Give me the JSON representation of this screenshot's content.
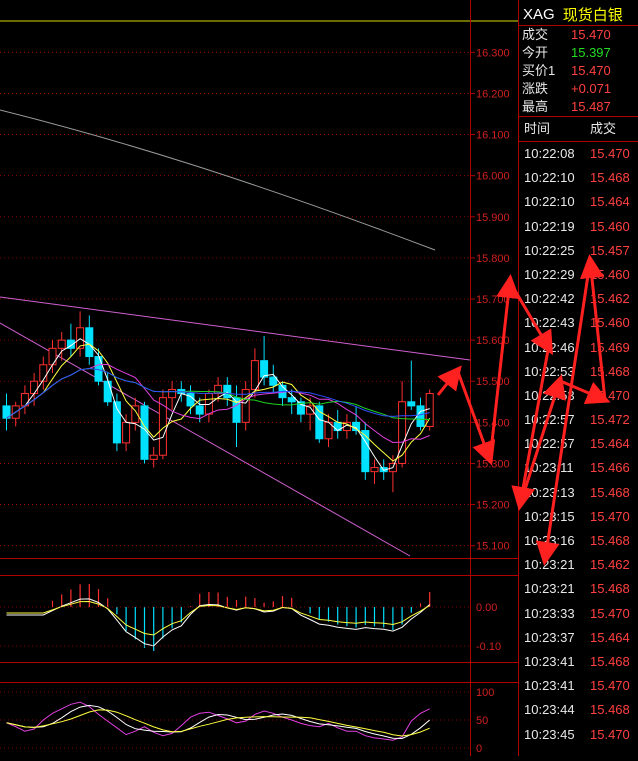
{
  "header": {
    "symbol": "XAG",
    "name": "现货白银"
  },
  "quote": [
    {
      "label": "成交",
      "value": "15.470",
      "color": "#ff4040"
    },
    {
      "label": "今开",
      "value": "15.397",
      "color": "#22dd22"
    },
    {
      "label": "买价1",
      "value": "15.470",
      "color": "#ff4040"
    },
    {
      "label": "涨跌",
      "value": "+0.071",
      "color": "#ff4040"
    },
    {
      "label": "最高",
      "value": "15.487",
      "color": "#ff4040"
    }
  ],
  "ticks": {
    "time_header": "时间",
    "price_header": "成交",
    "rows": [
      {
        "time": "10:22:08",
        "price": "15.470"
      },
      {
        "time": "10:22:10",
        "price": "15.468"
      },
      {
        "time": "10:22:10",
        "price": "15.464"
      },
      {
        "time": "10:22:19",
        "price": "15.460"
      },
      {
        "time": "10:22:25",
        "price": "15.457"
      },
      {
        "time": "10:22:29",
        "price": "15.460"
      },
      {
        "time": "10:22:42",
        "price": "15.462"
      },
      {
        "time": "10:22:43",
        "price": "15.460"
      },
      {
        "time": "10:22:46",
        "price": "15.469"
      },
      {
        "time": "10:22:53",
        "price": "15.468"
      },
      {
        "time": "10:22:53",
        "price": "15.470"
      },
      {
        "time": "10:22:57",
        "price": "15.472"
      },
      {
        "time": "10:22:57",
        "price": "15.464"
      },
      {
        "time": "10:23:11",
        "price": "15.466"
      },
      {
        "time": "10:23:13",
        "price": "15.468"
      },
      {
        "time": "10:23:15",
        "price": "15.470"
      },
      {
        "time": "10:23:16",
        "price": "15.468"
      },
      {
        "time": "10:23:21",
        "price": "15.462"
      },
      {
        "time": "10:23:21",
        "price": "15.468"
      },
      {
        "time": "10:23:33",
        "price": "15.470"
      },
      {
        "time": "10:23:37",
        "price": "15.464"
      },
      {
        "time": "10:23:41",
        "price": "15.468"
      },
      {
        "time": "10:23:41",
        "price": "15.470"
      },
      {
        "time": "10:23:44",
        "price": "15.468"
      },
      {
        "time": "10:23:45",
        "price": "15.470"
      }
    ]
  },
  "chart_data": [
    {
      "type": "candlestick",
      "y_ticks": [
        "16.300",
        "16.200",
        "16.100",
        "16.000",
        "15.900",
        "15.800",
        "15.700",
        "15.600",
        "15.500",
        "15.400",
        "15.300",
        "15.200",
        "15.100"
      ],
      "ylim": [
        15.07,
        16.33
      ],
      "candles": [
        {
          "o": 15.44,
          "h": 15.47,
          "l": 15.38,
          "c": 15.41
        },
        {
          "o": 15.41,
          "h": 15.45,
          "l": 15.39,
          "c": 15.44
        },
        {
          "o": 15.44,
          "h": 15.49,
          "l": 15.42,
          "c": 15.47
        },
        {
          "o": 15.47,
          "h": 15.52,
          "l": 15.44,
          "c": 15.5
        },
        {
          "o": 15.5,
          "h": 15.56,
          "l": 15.48,
          "c": 15.54
        },
        {
          "o": 15.54,
          "h": 15.6,
          "l": 15.52,
          "c": 15.58
        },
        {
          "o": 15.58,
          "h": 15.62,
          "l": 15.55,
          "c": 15.6
        },
        {
          "o": 15.6,
          "h": 15.64,
          "l": 15.56,
          "c": 15.58
        },
        {
          "o": 15.58,
          "h": 15.67,
          "l": 15.56,
          "c": 15.63
        },
        {
          "o": 15.63,
          "h": 15.66,
          "l": 15.54,
          "c": 15.56
        },
        {
          "o": 15.56,
          "h": 15.58,
          "l": 15.49,
          "c": 15.5
        },
        {
          "o": 15.5,
          "h": 15.52,
          "l": 15.44,
          "c": 15.45
        },
        {
          "o": 15.45,
          "h": 15.47,
          "l": 15.33,
          "c": 15.35
        },
        {
          "o": 15.35,
          "h": 15.42,
          "l": 15.33,
          "c": 15.4
        },
        {
          "o": 15.4,
          "h": 15.46,
          "l": 15.38,
          "c": 15.44
        },
        {
          "o": 15.44,
          "h": 15.45,
          "l": 15.3,
          "c": 15.31
        },
        {
          "o": 15.31,
          "h": 15.34,
          "l": 15.29,
          "c": 15.32
        },
        {
          "o": 15.32,
          "h": 15.48,
          "l": 15.31,
          "c": 15.46
        },
        {
          "o": 15.46,
          "h": 15.5,
          "l": 15.43,
          "c": 15.48
        },
        {
          "o": 15.48,
          "h": 15.5,
          "l": 15.45,
          "c": 15.47
        },
        {
          "o": 15.47,
          "h": 15.49,
          "l": 15.42,
          "c": 15.44
        },
        {
          "o": 15.44,
          "h": 15.46,
          "l": 15.4,
          "c": 15.42
        },
        {
          "o": 15.42,
          "h": 15.48,
          "l": 15.4,
          "c": 15.47
        },
        {
          "o": 15.47,
          "h": 15.51,
          "l": 15.45,
          "c": 15.49
        },
        {
          "o": 15.49,
          "h": 15.51,
          "l": 15.44,
          "c": 15.46
        },
        {
          "o": 15.46,
          "h": 15.49,
          "l": 15.34,
          "c": 15.4
        },
        {
          "o": 15.4,
          "h": 15.5,
          "l": 15.38,
          "c": 15.48
        },
        {
          "o": 15.48,
          "h": 15.58,
          "l": 15.46,
          "c": 15.55
        },
        {
          "o": 15.55,
          "h": 15.61,
          "l": 15.49,
          "c": 15.51
        },
        {
          "o": 15.51,
          "h": 15.54,
          "l": 15.47,
          "c": 15.49
        },
        {
          "o": 15.49,
          "h": 15.5,
          "l": 15.44,
          "c": 15.46
        },
        {
          "o": 15.46,
          "h": 15.48,
          "l": 15.42,
          "c": 15.45
        },
        {
          "o": 15.45,
          "h": 15.46,
          "l": 15.4,
          "c": 15.42
        },
        {
          "o": 15.42,
          "h": 15.46,
          "l": 15.38,
          "c": 15.44
        },
        {
          "o": 15.44,
          "h": 15.45,
          "l": 15.35,
          "c": 15.36
        },
        {
          "o": 15.36,
          "h": 15.42,
          "l": 15.34,
          "c": 15.4
        },
        {
          "o": 15.4,
          "h": 15.43,
          "l": 15.36,
          "c": 15.38
        },
        {
          "o": 15.38,
          "h": 15.42,
          "l": 15.36,
          "c": 15.4
        },
        {
          "o": 15.4,
          "h": 15.44,
          "l": 15.37,
          "c": 15.38
        },
        {
          "o": 15.38,
          "h": 15.4,
          "l": 15.26,
          "c": 15.28
        },
        {
          "o": 15.28,
          "h": 15.31,
          "l": 15.25,
          "c": 15.29
        },
        {
          "o": 15.29,
          "h": 15.31,
          "l": 15.26,
          "c": 15.28
        },
        {
          "o": 15.28,
          "h": 15.32,
          "l": 15.23,
          "c": 15.3
        },
        {
          "o": 15.3,
          "h": 15.5,
          "l": 15.29,
          "c": 15.45
        },
        {
          "o": 15.45,
          "h": 15.55,
          "l": 15.43,
          "c": 15.44
        },
        {
          "o": 15.44,
          "h": 15.46,
          "l": 15.38,
          "c": 15.39
        },
        {
          "o": 15.39,
          "h": 15.48,
          "l": 15.38,
          "c": 15.47
        }
      ]
    },
    {
      "type": "histogram",
      "y_ticks": [
        "0.00",
        "-0.10"
      ]
    },
    {
      "type": "line",
      "y_ticks": [
        "100",
        "50",
        "0"
      ]
    }
  ],
  "colors": {
    "up": "#ff3030",
    "down": "#00e0ff",
    "grid": "#b00000",
    "annotation_arrow": "#ff2020"
  }
}
